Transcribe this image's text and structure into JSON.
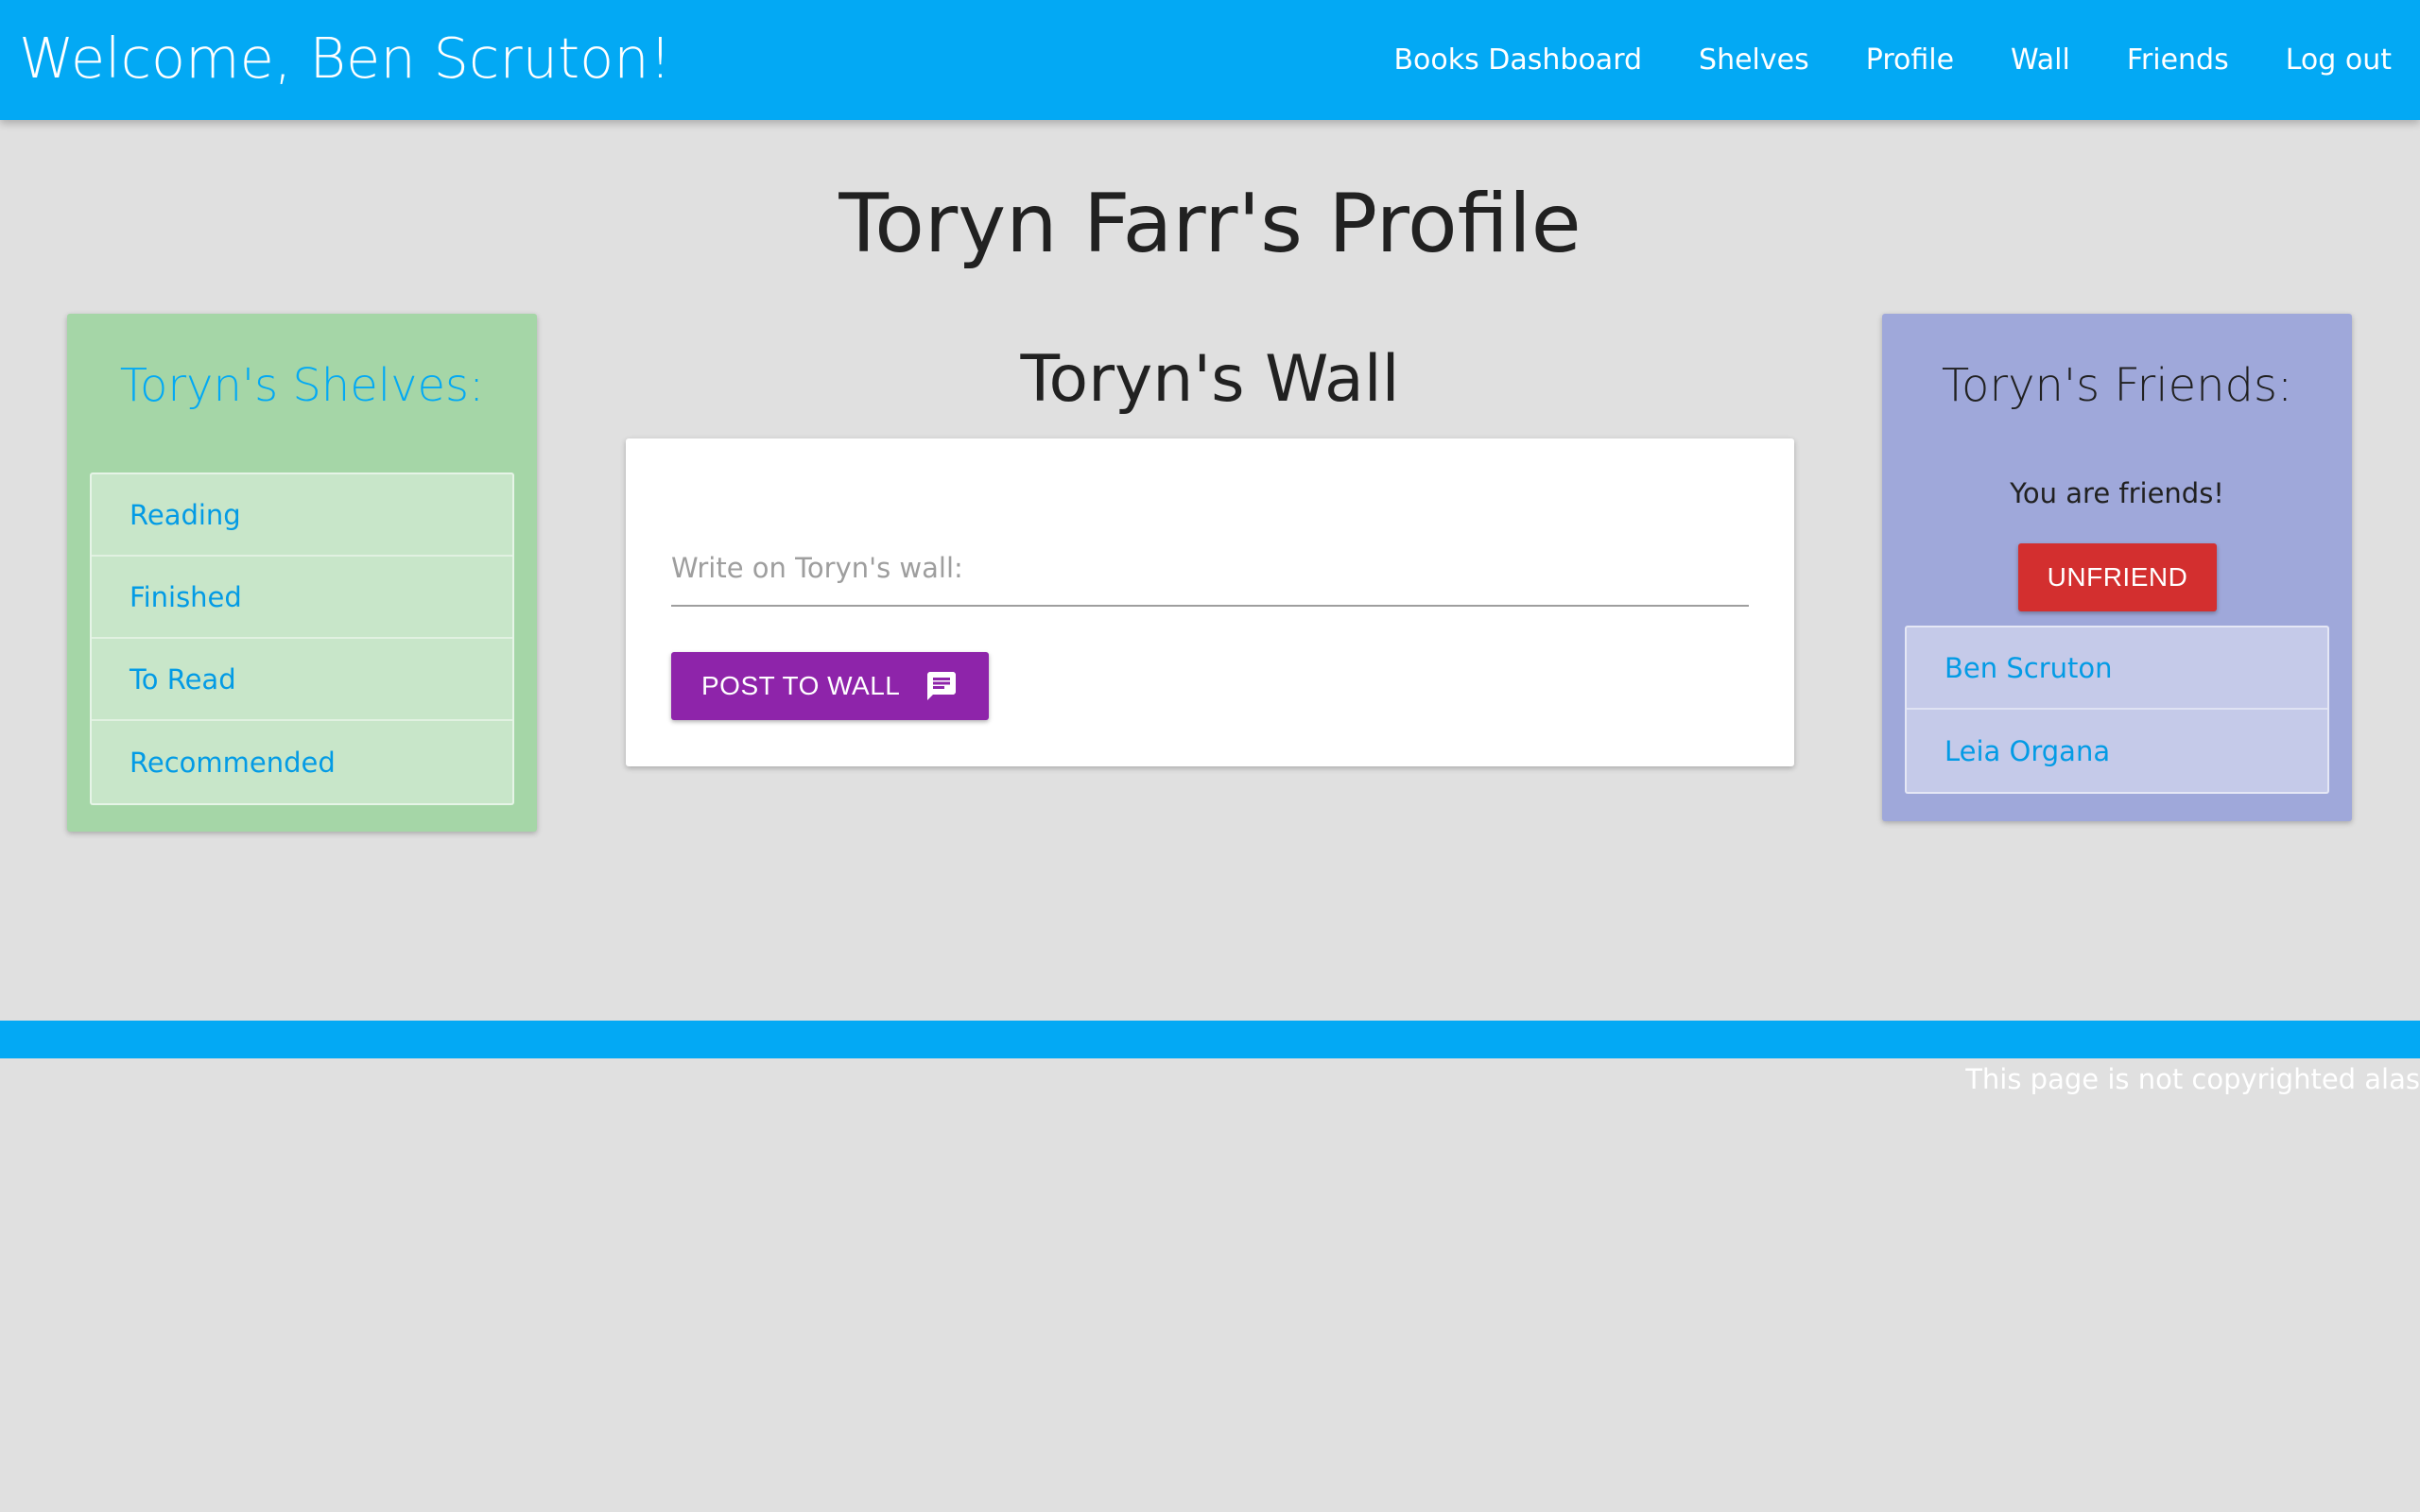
{
  "header": {
    "welcome": "Welcome, Ben Scruton!",
    "nav": [
      {
        "label": "Books Dashboard"
      },
      {
        "label": "Shelves"
      },
      {
        "label": "Profile"
      },
      {
        "label": "Wall"
      },
      {
        "label": "Friends"
      },
      {
        "label": "Log out"
      }
    ]
  },
  "page": {
    "title": "Toryn Farr's Profile"
  },
  "shelves": {
    "title": "Toryn's Shelves:",
    "items": [
      {
        "label": "Reading"
      },
      {
        "label": "Finished"
      },
      {
        "label": "To Read"
      },
      {
        "label": "Recommended"
      }
    ]
  },
  "wall": {
    "title": "Toryn's Wall",
    "input_value": "",
    "input_placeholder": "Write on Toryn's wall:",
    "post_label": "POST TO WALL",
    "post_icon": "chat-message-icon"
  },
  "friends": {
    "title": "Toryn's Friends:",
    "status": "You are friends!",
    "unfriend_label": "UNFRIEND",
    "items": [
      {
        "label": "Ben Scruton"
      },
      {
        "label": "Leia Organa"
      }
    ]
  },
  "footer": {
    "text": "This page is not copyrighted alas"
  },
  "colors": {
    "primary": "#03a9f4",
    "shelves_card": "#a5d6a7",
    "friends_card": "#9fa8da",
    "post_button": "#8e24aa",
    "unfriend_button": "#d32f2f"
  }
}
